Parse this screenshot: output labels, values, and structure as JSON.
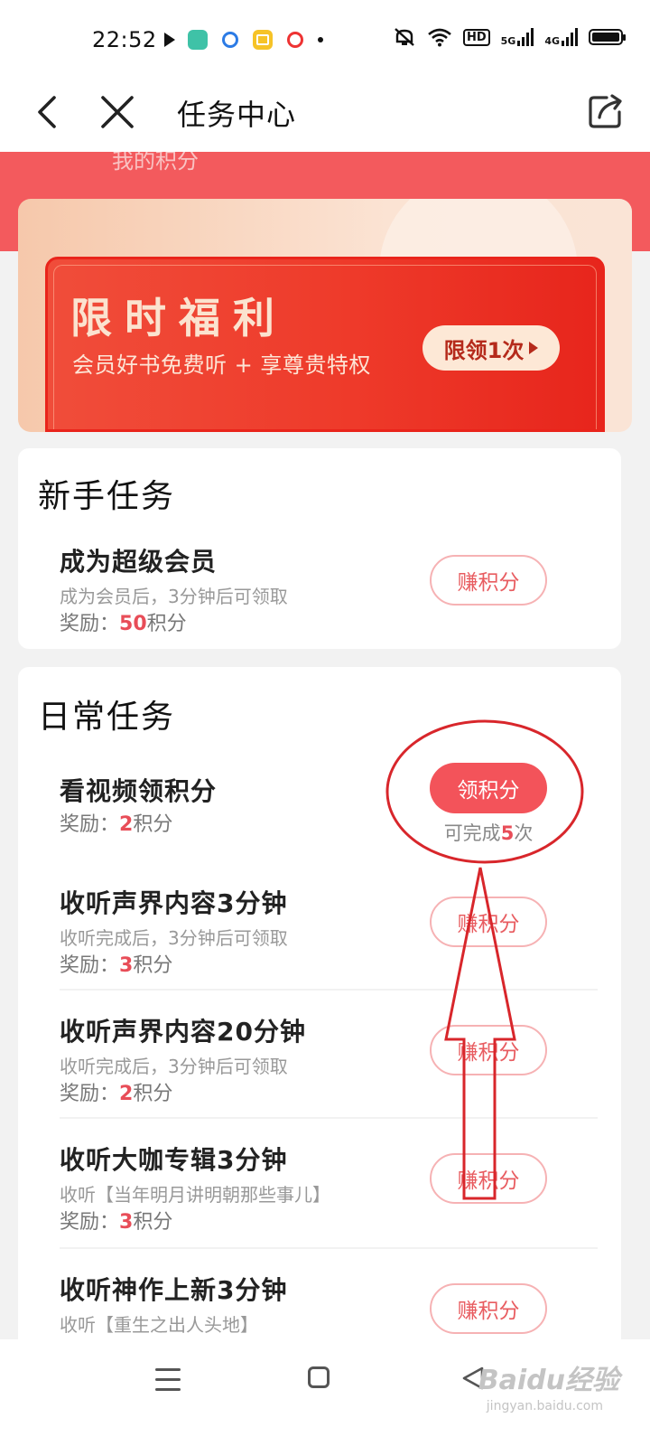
{
  "status_bar": {
    "time": "22:52",
    "right_icons": [
      "mute-icon",
      "wifi-icon",
      "HD",
      "5G",
      "4G",
      "battery-icon"
    ],
    "hd_label": "HD",
    "net1_label": "5G",
    "net2_label": "4G"
  },
  "nav": {
    "title": "任务中心",
    "back_icon": "chevron-left-icon",
    "close_icon": "close-icon",
    "share_icon": "share-icon"
  },
  "header": {
    "points_label": "我的积分"
  },
  "banner": {
    "title": "限时福利",
    "subtitle": "会员好书免费听 + 享尊贵特权",
    "button_label": "限领1次"
  },
  "newbie": {
    "title": "新手任务",
    "tasks": [
      {
        "name": "成为超级会员",
        "desc": "成为会员后，3分钟后可领取",
        "reward_prefix": "奖励：",
        "reward_value": "50",
        "reward_unit": "积分",
        "button": "赚积分"
      }
    ]
  },
  "daily": {
    "title": "日常任务",
    "tasks": [
      {
        "name": "看视频领积分",
        "reward_prefix": "奖励：",
        "reward_value": "2",
        "reward_unit": "积分",
        "button": "领积分",
        "remain_prefix": "可完成",
        "remain_count": "5",
        "remain_unit": "次"
      },
      {
        "name": "收听声界内容3分钟",
        "desc": "收听完成后，3分钟后可领取",
        "reward_prefix": "奖励：",
        "reward_value": "3",
        "reward_unit": "积分",
        "button": "赚积分"
      },
      {
        "name": "收听声界内容20分钟",
        "desc": "收听完成后，3分钟后可领取",
        "reward_prefix": "奖励：",
        "reward_value": "2",
        "reward_unit": "积分",
        "button": "赚积分"
      },
      {
        "name": "收听大咖专辑3分钟",
        "desc": "收听【当年明月讲明朝那些事儿】",
        "reward_prefix": "奖励：",
        "reward_value": "3",
        "reward_unit": "积分",
        "button": "赚积分"
      },
      {
        "name": "收听神作上新3分钟",
        "desc": "收听【重生之出人头地】",
        "button": "赚积分"
      }
    ]
  },
  "watermark": {
    "brand": "Baidu经验",
    "url": "jingyan.baidu.com"
  },
  "colors": {
    "accent": "#f3535a",
    "header_red": "#f35a5d",
    "banner_red": "#ee3a2a",
    "annotation_red": "#d8262b"
  }
}
